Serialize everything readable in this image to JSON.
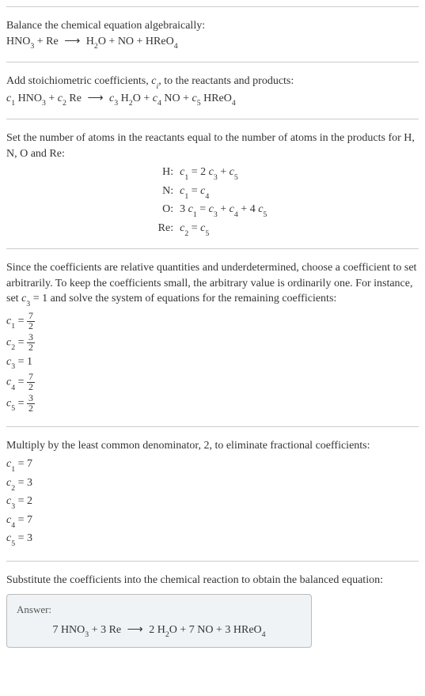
{
  "section1": {
    "line1": "Balance the chemical equation algebraically:",
    "eq_lhs1": "HNO",
    "eq_sub1": "3",
    "eq_plus1": " + Re ",
    "arrow": "⟶",
    "eq_rhs1": " H",
    "eq_sub2": "2",
    "eq_rhs2": "O + NO + HReO",
    "eq_sub3": "4"
  },
  "section2": {
    "line1a": "Add stoichiometric coefficients, ",
    "ci": "c",
    "ci_sub": "i",
    "line1b": ", to the reactants and products:",
    "c1": "c",
    "c1s": "1",
    "sp1": " HNO",
    "sp1s": "3",
    "plus1": " + ",
    "c2": "c",
    "c2s": "2",
    "sp2": " Re ",
    "arrow": "⟶",
    "c3": "c",
    "c3s": "3",
    "sp3": " H",
    "sp3s": "2",
    "sp3b": "O + ",
    "c4": "c",
    "c4s": "4",
    "sp4": " NO + ",
    "c5": "c",
    "c5s": "5",
    "sp5": " HReO",
    "sp5s": "4"
  },
  "section3": {
    "intro": "Set the number of atoms in the reactants equal to the number of atoms in the products for H, N, O and Re:",
    "rows": [
      {
        "label": "H:",
        "c1": "c",
        "c1s": "1",
        "eq": " = 2 ",
        "c3": "c",
        "c3s": "3",
        "plus": " + ",
        "c5": "c",
        "c5s": "5"
      },
      {
        "label": "N:",
        "c1": "c",
        "c1s": "1",
        "eq": " = ",
        "c4": "c",
        "c4s": "4"
      },
      {
        "label": "O:",
        "pre": "3 ",
        "c1": "c",
        "c1s": "1",
        "eq": " = ",
        "c3": "c",
        "c3s": "3",
        "plus1": " + ",
        "c4": "c",
        "c4s": "4",
        "plus2": " + 4 ",
        "c5": "c",
        "c5s": "5"
      },
      {
        "label": "Re:",
        "c2": "c",
        "c2s": "2",
        "eq": " = ",
        "c5": "c",
        "c5s": "5"
      }
    ]
  },
  "section4": {
    "intro1": "Since the coefficients are relative quantities and underdetermined, choose a coefficient to set arbitrarily. To keep the coefficients small, the arbitrary value is ordinarily one. For instance, set ",
    "c3": "c",
    "c3s": "3",
    "intro2": " = 1 and solve the system of equations for the remaining coefficients:",
    "coefs": [
      {
        "c": "c",
        "s": "1",
        "eq": " = ",
        "num": "7",
        "den": "2"
      },
      {
        "c": "c",
        "s": "2",
        "eq": " = ",
        "num": "3",
        "den": "2"
      },
      {
        "c": "c",
        "s": "3",
        "eq": " = 1",
        "whole": true
      },
      {
        "c": "c",
        "s": "4",
        "eq": " = ",
        "num": "7",
        "den": "2"
      },
      {
        "c": "c",
        "s": "5",
        "eq": " = ",
        "num": "3",
        "den": "2"
      }
    ]
  },
  "section5": {
    "intro": "Multiply by the least common denominator, 2, to eliminate fractional coefficients:",
    "coefs": [
      {
        "c": "c",
        "s": "1",
        "val": " = 7"
      },
      {
        "c": "c",
        "s": "2",
        "val": " = 3"
      },
      {
        "c": "c",
        "s": "3",
        "val": " = 2"
      },
      {
        "c": "c",
        "s": "4",
        "val": " = 7"
      },
      {
        "c": "c",
        "s": "5",
        "val": " = 3"
      }
    ]
  },
  "section6": {
    "intro": "Substitute the coefficients into the chemical reaction to obtain the balanced equation:",
    "answer_label": "Answer:",
    "eq": {
      "p1": "7 HNO",
      "s1": "3",
      "p2": " + 3 Re ",
      "arrow": "⟶",
      "p3": " 2 H",
      "s2": "2",
      "p4": "O + 7 NO + 3 HReO",
      "s3": "4"
    }
  },
  "chart_data": {
    "type": "table",
    "title": "Balanced chemical equation coefficients",
    "equation": "7 HNO3 + 3 Re → 2 H2O + 7 NO + 3 HReO4",
    "atom_balance": [
      {
        "element": "H",
        "equation": "c1 = 2 c3 + c5"
      },
      {
        "element": "N",
        "equation": "c1 = c4"
      },
      {
        "element": "O",
        "equation": "3 c1 = c3 + c4 + 4 c5"
      },
      {
        "element": "Re",
        "equation": "c2 = c5"
      }
    ],
    "fractional_coefficients": {
      "c1": "7/2",
      "c2": "3/2",
      "c3": "1",
      "c4": "7/2",
      "c5": "3/2"
    },
    "integer_coefficients": {
      "c1": 7,
      "c2": 3,
      "c3": 2,
      "c4": 7,
      "c5": 3
    }
  }
}
